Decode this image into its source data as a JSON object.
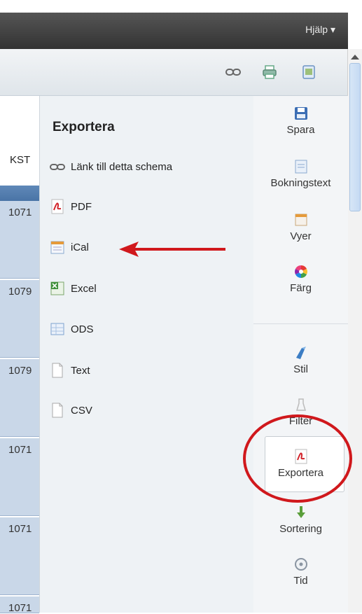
{
  "header": {
    "help_label": "Hjälp ▾"
  },
  "toolbar": {
    "icons": [
      "link-icon",
      "print-icon",
      "page-icon"
    ]
  },
  "grid": {
    "column_header": "KST",
    "rows": [
      "1071",
      "1079",
      "1079",
      "1071",
      "1071",
      "1071"
    ]
  },
  "export_panel": {
    "title": "Exportera",
    "items": [
      {
        "label": "Länk till detta schema",
        "icon": "link-icon"
      },
      {
        "label": "PDF",
        "icon": "pdf-icon"
      },
      {
        "label": "iCal",
        "icon": "calendar-icon"
      },
      {
        "label": "Excel",
        "icon": "excel-icon"
      },
      {
        "label": "ODS",
        "icon": "ods-icon"
      },
      {
        "label": "Text",
        "icon": "text-file-icon"
      },
      {
        "label": "CSV",
        "icon": "csv-file-icon"
      }
    ]
  },
  "sidebar": {
    "items": [
      {
        "label": "Spara",
        "icon": "save-icon"
      },
      {
        "label": "Bokningstext",
        "icon": "booking-text-icon"
      },
      {
        "label": "Vyer",
        "icon": "views-icon"
      },
      {
        "label": "Färg",
        "icon": "color-wheel-icon"
      },
      {
        "label": "Stil",
        "icon": "style-icon"
      },
      {
        "label": "Filter",
        "icon": "filter-icon"
      },
      {
        "label": "Exportera",
        "icon": "pdf-icon"
      },
      {
        "label": "Sortering",
        "icon": "sort-icon"
      },
      {
        "label": "Tid",
        "icon": "clock-icon"
      }
    ]
  },
  "colors": {
    "annotation": "#d0181c",
    "header_dark": "#3a3a3a"
  }
}
